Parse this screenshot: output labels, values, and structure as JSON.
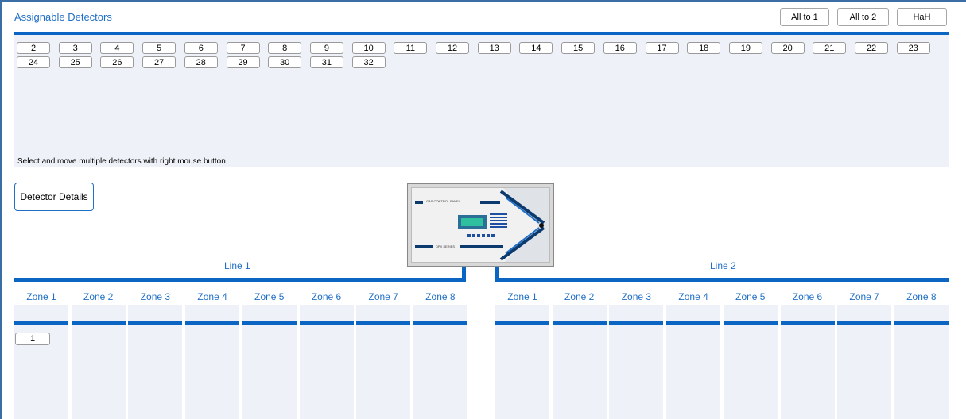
{
  "header": {
    "title": "Assignable Detectors",
    "all_to_1": "All to 1",
    "all_to_2": "All to 2",
    "hah": "HaH"
  },
  "pool": {
    "row1": [
      "2",
      "3",
      "4",
      "5",
      "6",
      "7",
      "8",
      "9",
      "10",
      "11",
      "12",
      "13",
      "14",
      "15",
      "16",
      "17",
      "18",
      "19",
      "20",
      "21",
      "22",
      "23"
    ],
    "row2": [
      "24",
      "25",
      "26",
      "27",
      "28",
      "29",
      "30",
      "31",
      "32"
    ],
    "hint": "Select and move multiple detectors with right mouse button."
  },
  "details_button": "Detector Details",
  "panel_image": {
    "label_top": "GAS CONTROL PANEL",
    "label_bottom": "DPX SERIES"
  },
  "line1": {
    "label": "Line 1",
    "zones": [
      "Zone 1",
      "Zone 2",
      "Zone 3",
      "Zone 4",
      "Zone 5",
      "Zone 6",
      "Zone 7",
      "Zone 8"
    ],
    "zone1_detectors": [
      "1"
    ]
  },
  "line2": {
    "label": "Line 2",
    "zones": [
      "Zone 1",
      "Zone 2",
      "Zone 3",
      "Zone 4",
      "Zone 5",
      "Zone 6",
      "Zone 7",
      "Zone 8"
    ]
  },
  "colors": {
    "accent": "#0b66c3",
    "title": "#1f6fc6",
    "zone_bg": "#eef2f8"
  }
}
